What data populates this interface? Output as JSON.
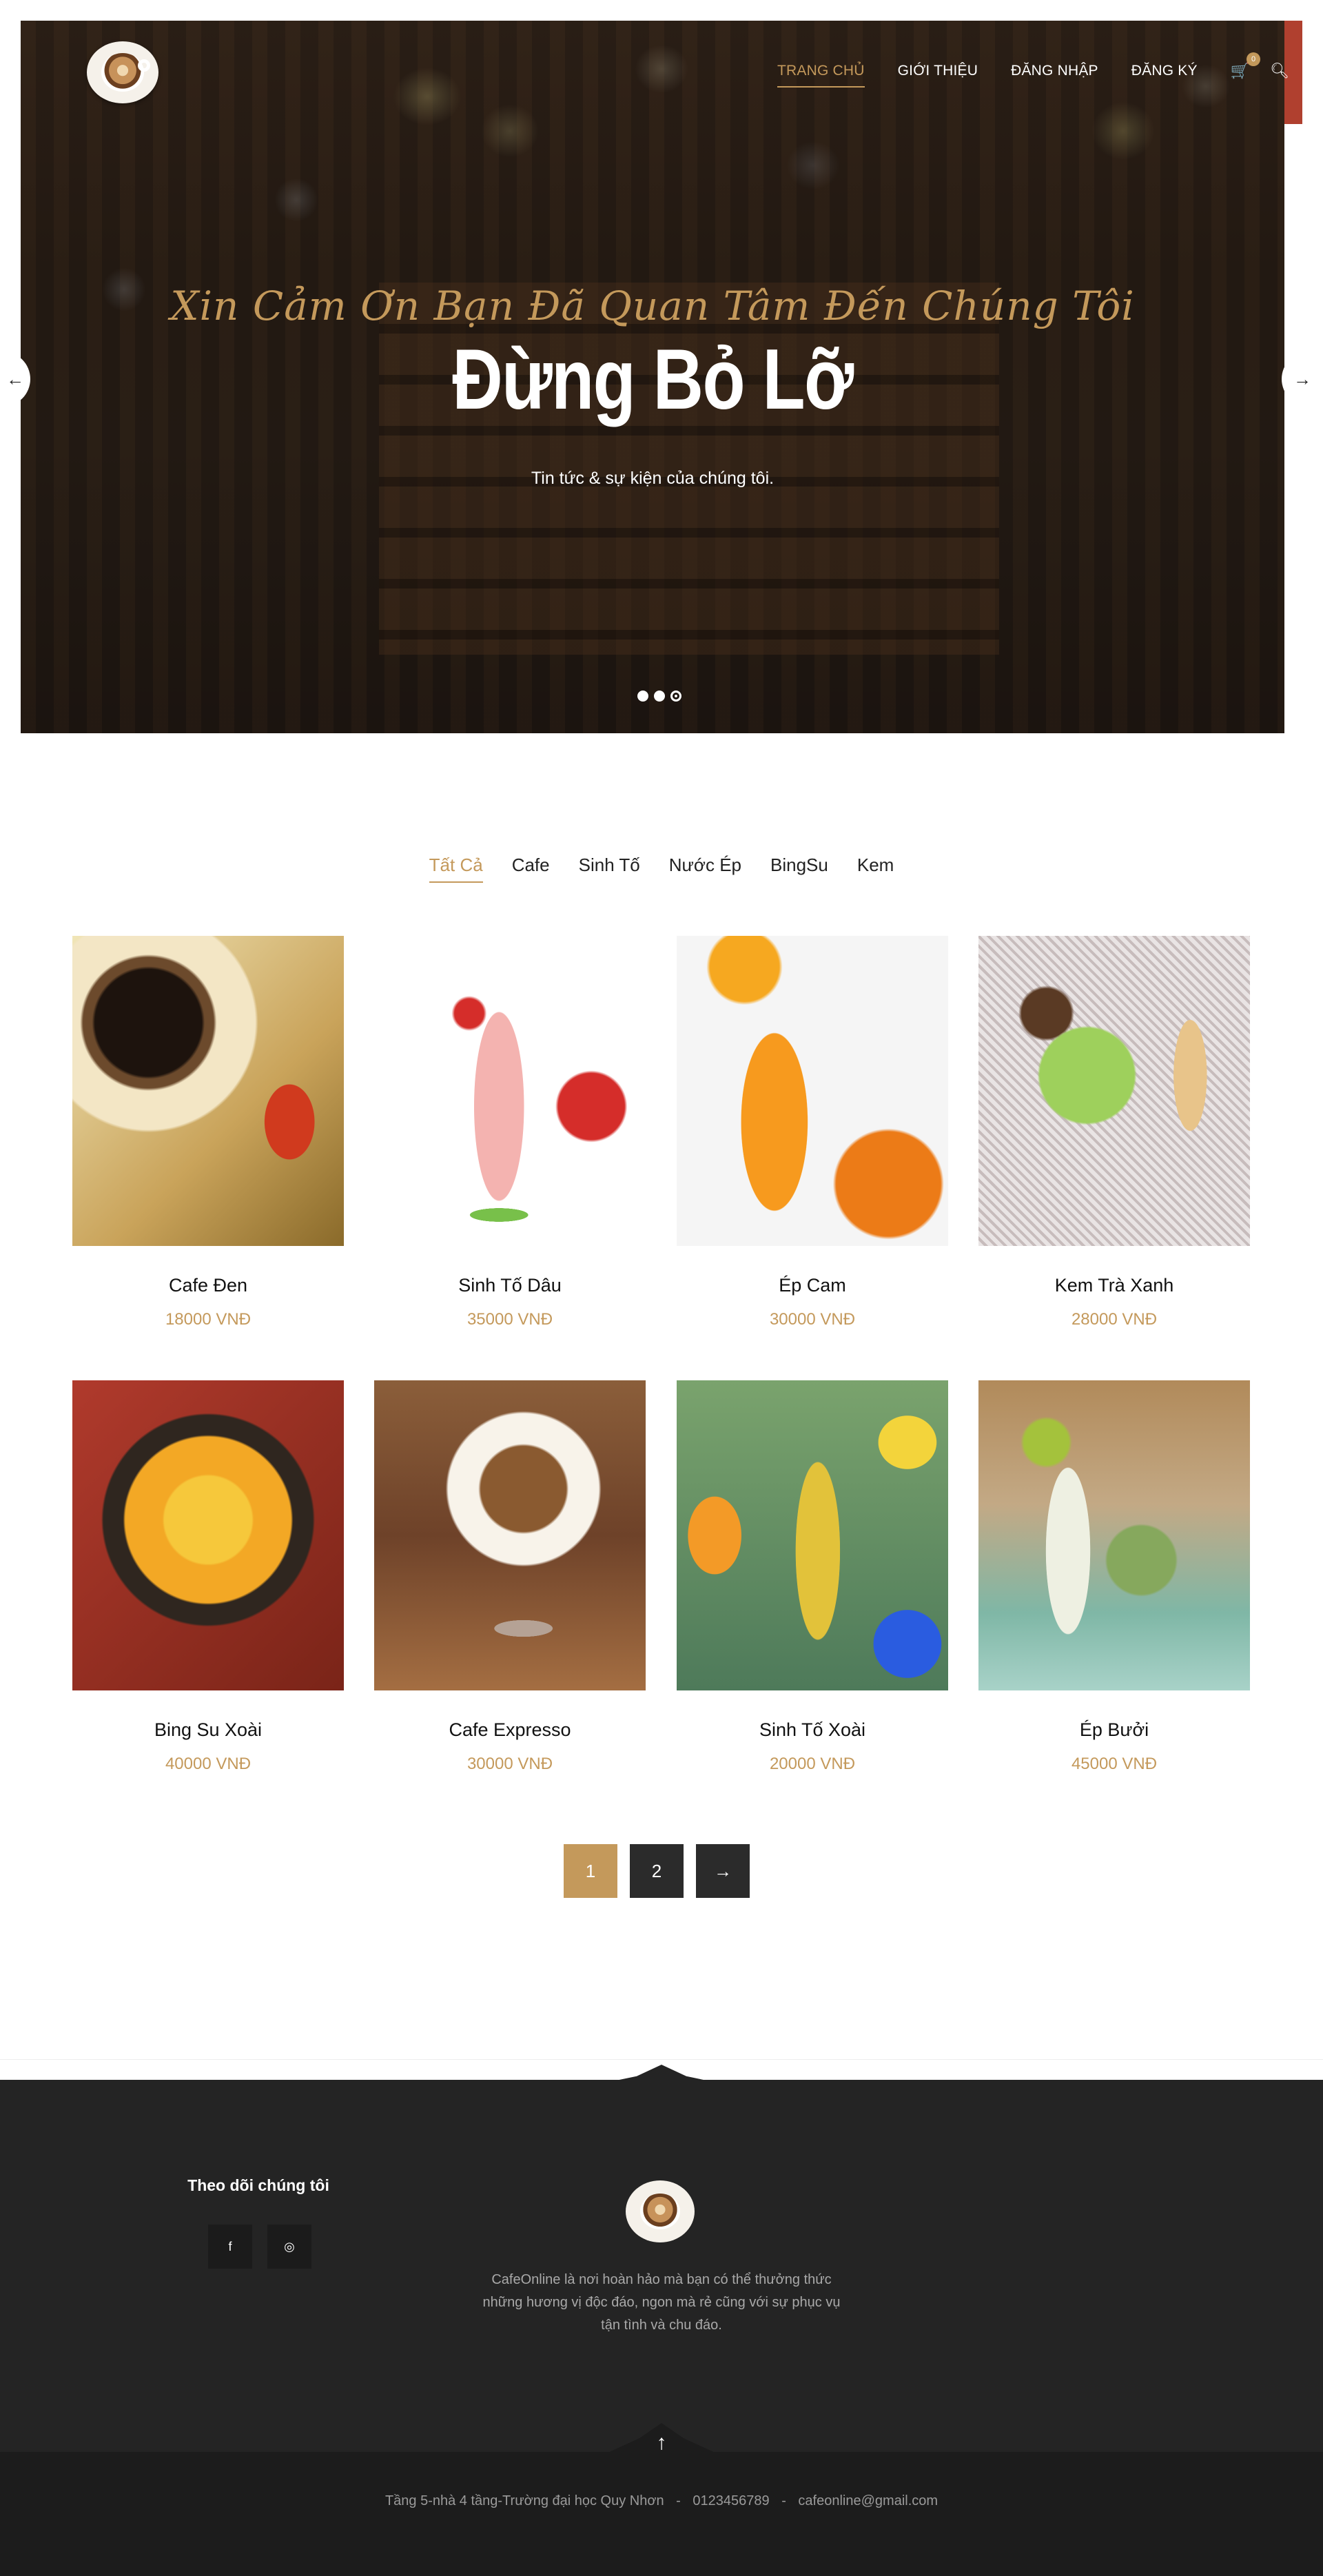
{
  "nav": {
    "items": [
      {
        "label": "TRANG CHỦ",
        "active": true
      },
      {
        "label": "GIỚI THIỆU"
      },
      {
        "label": "ĐĂNG NHẬP"
      },
      {
        "label": "ĐĂNG KÝ"
      }
    ],
    "cart_count": "0",
    "cart_icon": "cart-icon",
    "search_icon": "search-icon"
  },
  "hero": {
    "script_text": "Xin Cảm Ơn Bạn Đã Quan Tâm Đến Chúng Tôi",
    "title": "Đừng Bỏ Lỡ",
    "subtitle": "Tin tức & sự kiện của chúng tôi.",
    "slides": 3,
    "active_slide": 3,
    "prev_arrow": "←",
    "next_arrow": "→"
  },
  "filters": [
    "Tất Cả",
    "Cafe",
    "Sinh Tố",
    "Nước Ép",
    "BingSu",
    "Kem"
  ],
  "products": [
    {
      "name": "Cafe Đen",
      "price": "18000 VNĐ"
    },
    {
      "name": "Sinh Tố Dâu",
      "price": "35000 VNĐ"
    },
    {
      "name": "Ép Cam",
      "price": "30000 VNĐ"
    },
    {
      "name": "Kem Trà Xanh",
      "price": "28000 VNĐ"
    },
    {
      "name": "Bing Su Xoài",
      "price": "40000 VNĐ"
    },
    {
      "name": "Cafe Expresso",
      "price": "30000 VNĐ"
    },
    {
      "name": "Sinh Tố Xoài",
      "price": "20000 VNĐ"
    },
    {
      "name": "Ép Bưởi",
      "price": "45000 VNĐ"
    }
  ],
  "pagination": {
    "pages": [
      "1",
      "2"
    ],
    "active": "1",
    "next": "→"
  },
  "footer": {
    "follow_title": "Theo dõi chúng tôi",
    "social": [
      {
        "icon": "facebook-icon",
        "glyph": "f"
      },
      {
        "icon": "instagram-icon",
        "glyph": "◎"
      }
    ],
    "description": "CafeOnline là nơi hoàn hảo mà bạn có thể thưởng thức những hương vị độc đáo, ngon mà rẻ cũng với sự phục vụ tận tình và chu đáo.",
    "up_arrow": "↑",
    "address": "Tầng 5-nhà 4 tầng-Trường đại học Quy Nhơn",
    "phone": "0123456789",
    "email": "cafeonline@gmail.com",
    "separator": "-"
  },
  "colors": {
    "accent": "#c4995b",
    "dark": "#242424",
    "hero_overlay": "#2a1f18"
  }
}
